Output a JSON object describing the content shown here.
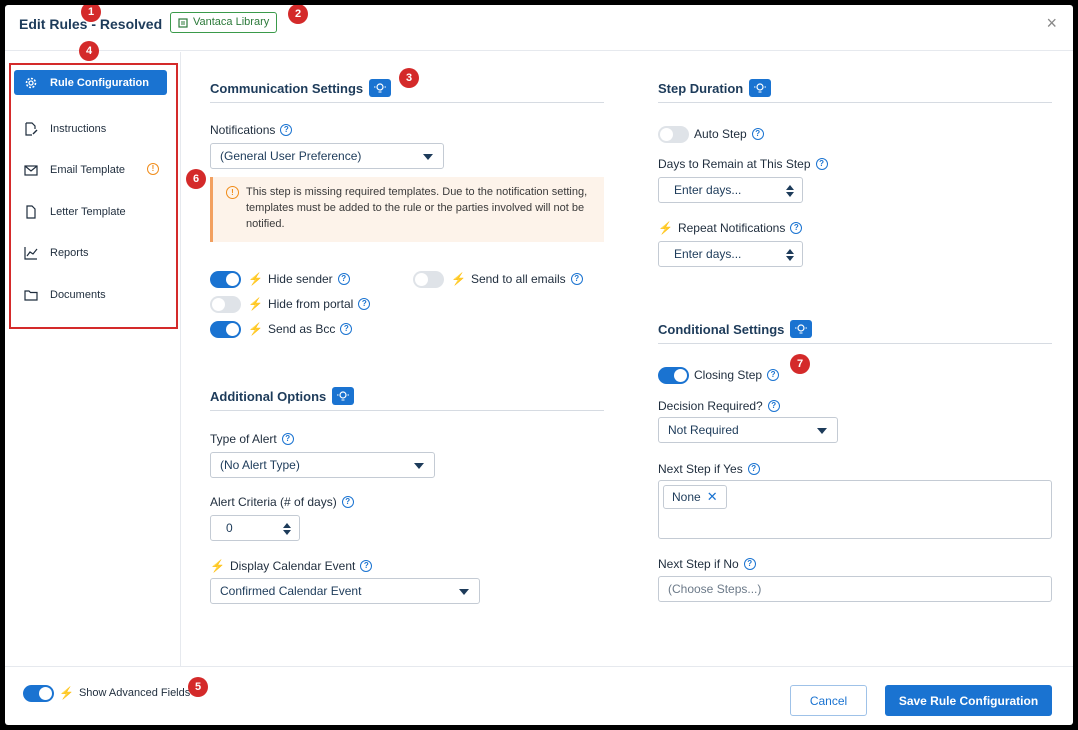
{
  "header": {
    "title": "Edit Rules - Resolved",
    "library_badge": "Vantaca Library",
    "close_label": "×"
  },
  "markers": [
    "1",
    "2",
    "3",
    "4",
    "5",
    "6",
    "7"
  ],
  "sidebar": {
    "items": [
      {
        "label": "Rule Configuration",
        "icon": "gear-icon",
        "active": true
      },
      {
        "label": "Instructions",
        "icon": "edit-doc-icon",
        "active": false
      },
      {
        "label": "Email Template",
        "icon": "envelope-icon",
        "active": false,
        "warning": "!"
      },
      {
        "label": "Letter Template",
        "icon": "document-icon",
        "active": false
      },
      {
        "label": "Reports",
        "icon": "chart-icon",
        "active": false
      },
      {
        "label": "Documents",
        "icon": "folder-icon",
        "active": false
      }
    ]
  },
  "communication": {
    "title": "Communication Settings",
    "notifications_label": "Notifications",
    "notifications_value": "(General User Preference)",
    "alert_text": "This step is missing required templates. Due to the notification setting, templates must be added to the rule or the parties involved will not be notified.",
    "alert_icon": "!",
    "toggles": [
      {
        "label": "Hide sender",
        "on": true
      },
      {
        "label": "Send to all emails",
        "on": false
      },
      {
        "label": "Hide from portal",
        "on": false
      },
      {
        "label": "Send as Bcc",
        "on": true
      }
    ]
  },
  "additional": {
    "title": "Additional Options",
    "alert_type_label": "Type of Alert",
    "alert_type_value": "(No Alert Type)",
    "criteria_label": "Alert Criteria (# of days)",
    "criteria_value": "0",
    "calendar_label": "Display Calendar Event",
    "calendar_value": "Confirmed Calendar Event"
  },
  "step_duration": {
    "title": "Step Duration",
    "auto_step_label": "Auto Step",
    "auto_step_on": false,
    "days_label": "Days to Remain at This Step",
    "days_placeholder": "Enter days...",
    "repeat_label": "Repeat Notifications",
    "repeat_placeholder": "Enter days..."
  },
  "conditional": {
    "title": "Conditional Settings",
    "closing_label": "Closing Step",
    "closing_on": true,
    "decision_label": "Decision Required?",
    "decision_value": "Not Required",
    "yes_label": "Next Step if Yes",
    "yes_chip": "None",
    "no_label": "Next Step if No",
    "no_placeholder": "(Choose Steps...)"
  },
  "footer": {
    "advanced_label": "Show Advanced Fields",
    "advanced_on": true,
    "cancel_label": "Cancel",
    "save_label": "Save Rule Configuration"
  },
  "colors": {
    "accent": "#1a73d1",
    "marker": "#d42a2a",
    "bolt": "#2ba24c",
    "warning": "#f08c1a"
  }
}
